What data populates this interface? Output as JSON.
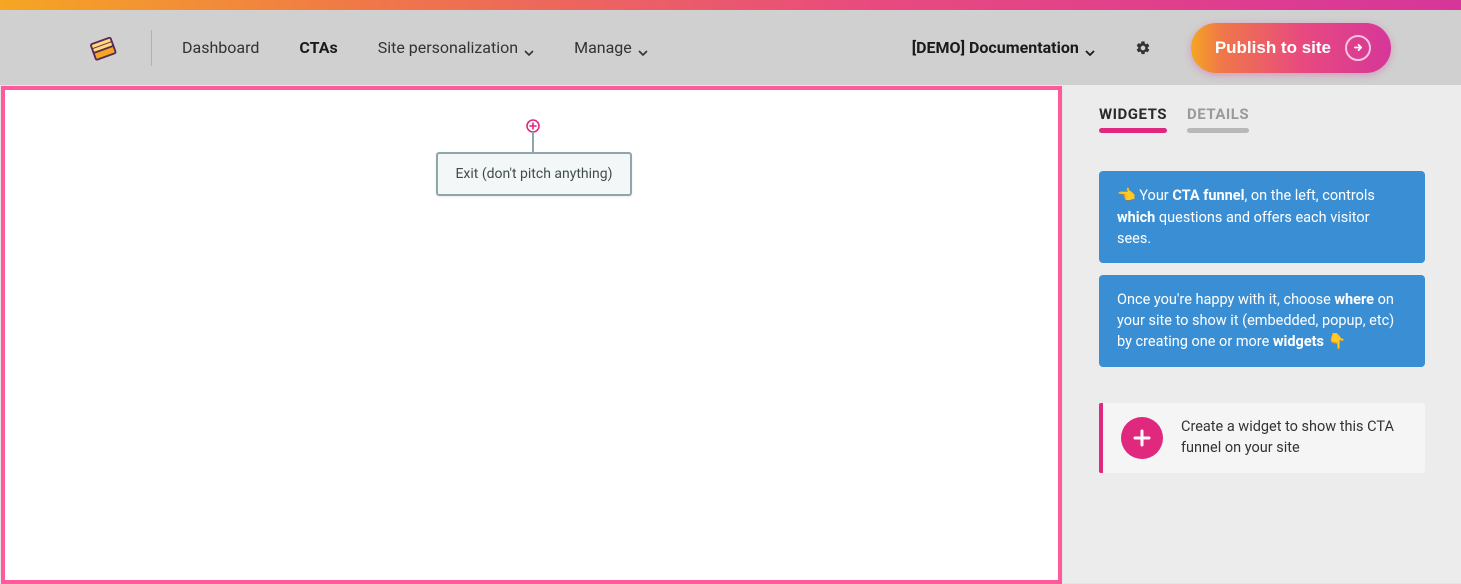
{
  "header": {
    "nav": {
      "dashboard": "Dashboard",
      "ctas": "CTAs",
      "site_personalization": "Site personalization",
      "manage": "Manage"
    },
    "demo_label": "[DEMO] Documentation",
    "publish_label": "Publish to site"
  },
  "canvas": {
    "node_label": "Exit (don't pitch anything)"
  },
  "sidebar": {
    "tabs": {
      "widgets": "WIDGETS",
      "details": "DETAILS"
    },
    "info1": {
      "pointer": "👈",
      "pre": "Your",
      "bold1": "CTA funnel",
      "mid": ", on the left, controls",
      "bold2": "which",
      "post": "questions and offers each visitor sees."
    },
    "info2": {
      "pre": "Once you're happy with it, choose",
      "bold1": "where",
      "mid": "on your site to show it (embedded, popup, etc) by creating one or more",
      "bold2": "widgets",
      "finger": "👇"
    },
    "create_widget_text": "Create a widget to show this CTA funnel on your site"
  }
}
